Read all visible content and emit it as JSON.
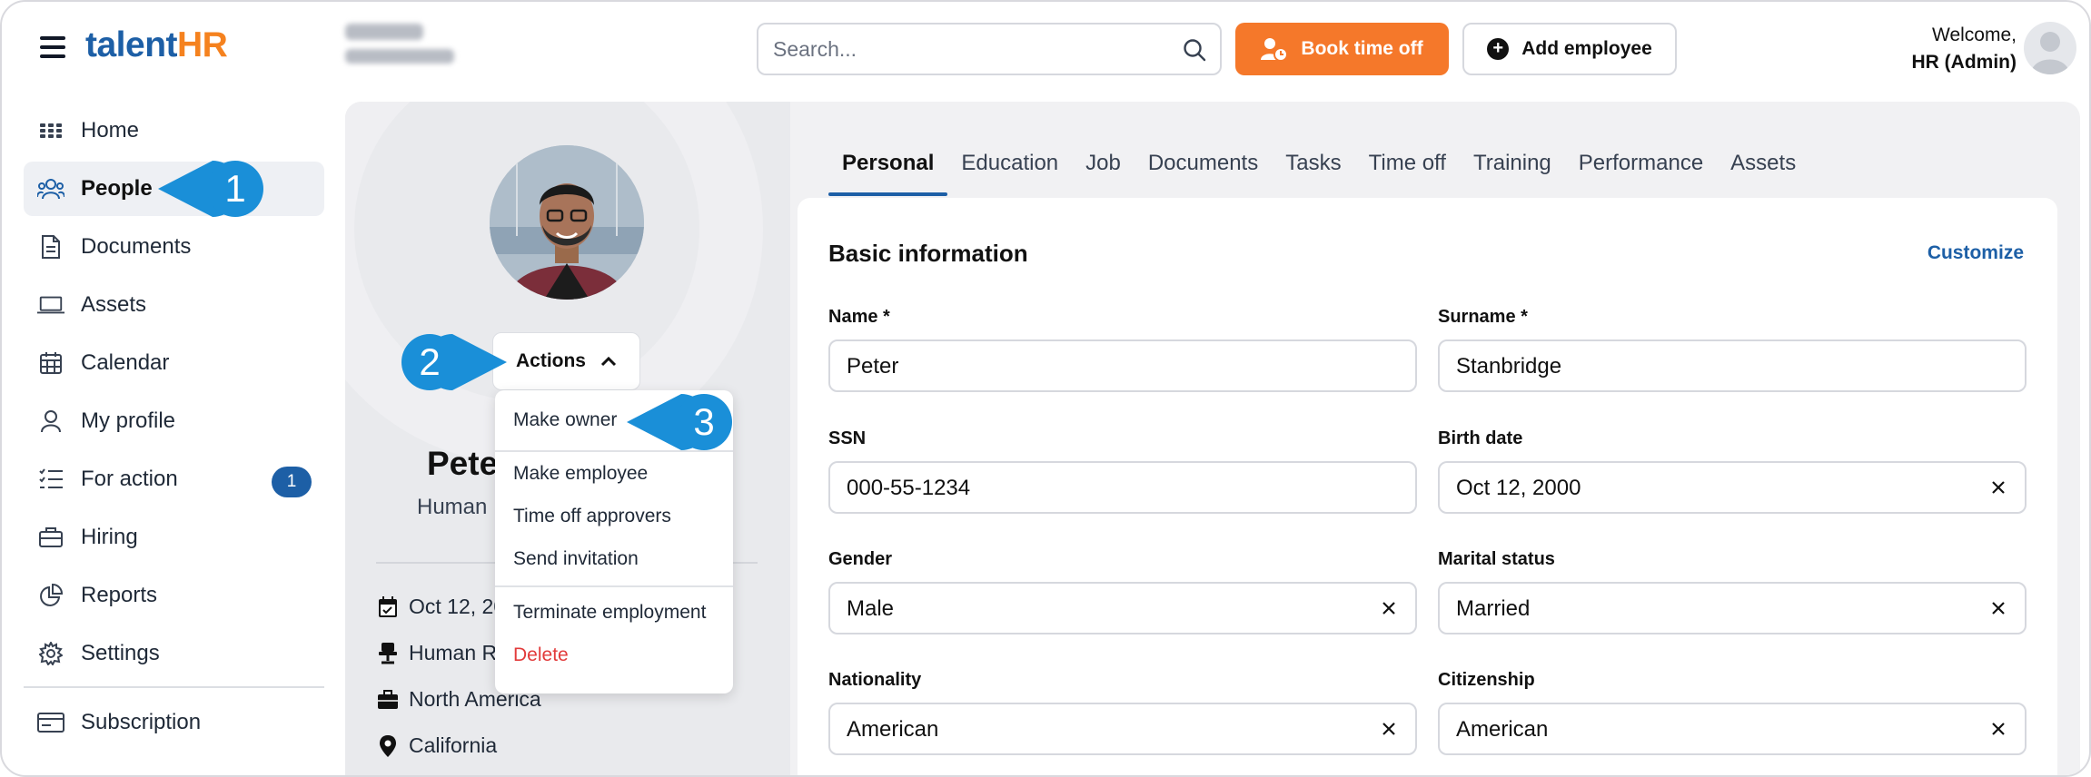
{
  "header": {
    "logo_part1": "talent",
    "logo_part2": "HR",
    "search_placeholder": "Search...",
    "book_time_off": "Book time off",
    "add_employee": "Add employee",
    "welcome": "Welcome,",
    "user_role": "HR (Admin)"
  },
  "sidebar": {
    "items": [
      {
        "label": "Home",
        "icon": "grid-icon"
      },
      {
        "label": "People",
        "icon": "people-icon"
      },
      {
        "label": "Documents",
        "icon": "document-icon"
      },
      {
        "label": "Assets",
        "icon": "laptop-icon"
      },
      {
        "label": "Calendar",
        "icon": "calendar-icon"
      },
      {
        "label": "My profile",
        "icon": "user-icon"
      },
      {
        "label": "For action",
        "icon": "checklist-icon",
        "badge": "1"
      },
      {
        "label": "Hiring",
        "icon": "briefcase-icon"
      },
      {
        "label": "Reports",
        "icon": "pie-chart-icon"
      },
      {
        "label": "Settings",
        "icon": "gear-icon"
      }
    ],
    "subscription": "Subscription"
  },
  "profile": {
    "name": "Pete",
    "department": "Human",
    "actions_label": "Actions",
    "info": [
      "Oct 12, 20",
      "Human Re",
      "North America",
      "California"
    ]
  },
  "actions_menu": {
    "items": [
      "Make owner",
      "Make employee",
      "Time off approvers",
      "Send invitation",
      "Terminate employment",
      "Delete"
    ]
  },
  "callouts": [
    "1",
    "2",
    "3"
  ],
  "tabs": [
    "Personal",
    "Education",
    "Job",
    "Documents",
    "Tasks",
    "Time off",
    "Training",
    "Performance",
    "Assets"
  ],
  "basic_info": {
    "title": "Basic information",
    "customize": "Customize",
    "fields": [
      {
        "label": "Name *",
        "value": "Peter"
      },
      {
        "label": "Surname *",
        "value": "Stanbridge"
      },
      {
        "label": "SSN",
        "value": "000-55-1234"
      },
      {
        "label": "Birth date",
        "value": "Oct 12, 2000"
      },
      {
        "label": "Gender",
        "value": "Male"
      },
      {
        "label": "Marital status",
        "value": "Married"
      },
      {
        "label": "Nationality",
        "value": "American"
      },
      {
        "label": "Citizenship",
        "value": "American"
      }
    ]
  },
  "colors": {
    "brand_blue": "#1d5fa6",
    "brand_orange": "#f5821f",
    "callout_blue": "#1a8fd8",
    "danger": "#e23b3b"
  }
}
